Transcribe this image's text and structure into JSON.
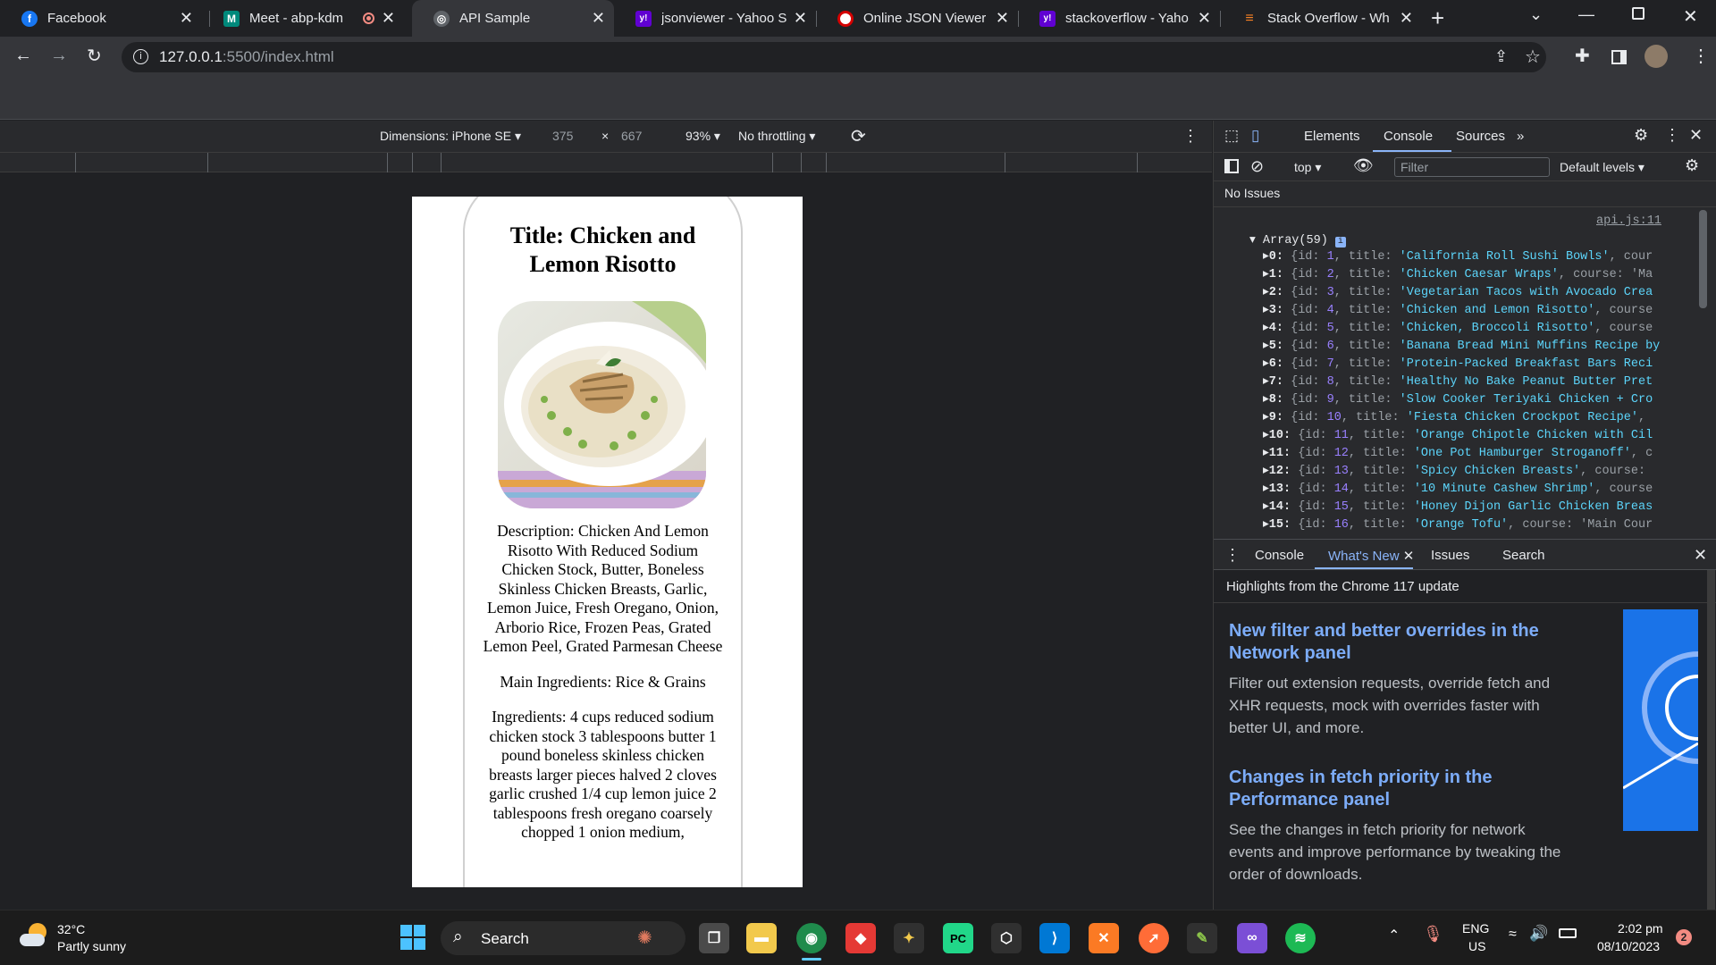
{
  "tabs": [
    {
      "label": "Facebook",
      "icon": "facebook-icon",
      "color": "#1877f2",
      "glyph": "f"
    },
    {
      "label": "Meet - abp-kdm",
      "icon": "meet-icon",
      "color": "#00897b",
      "glyph": "M"
    },
    {
      "label": "API Sample",
      "icon": "globe-icon",
      "color": "#5f6368",
      "glyph": "◎"
    },
    {
      "label": "jsonviewer - Yahoo S",
      "icon": "yahoo-icon",
      "color": "#6001d2",
      "glyph": "y!"
    },
    {
      "label": "Online JSON Viewer",
      "icon": "opera-icon",
      "color": "#d50000",
      "glyph": "O"
    },
    {
      "label": "stackoverflow - Yaho",
      "icon": "yahoo-icon",
      "color": "#6001d2",
      "glyph": "y!"
    },
    {
      "label": "Stack Overflow - Wh",
      "icon": "stackoverflow-icon",
      "color": "#f48024",
      "glyph": "≡"
    }
  ],
  "address": {
    "host": "127.0.0.1",
    "path": ":5500/index.html"
  },
  "device_toolbar": {
    "dimensions": "Dimensions: iPhone SE",
    "width": "375",
    "height": "667",
    "zoom": "93%",
    "throttling": "No throttling"
  },
  "page": {
    "title": "Title: Chicken and Lemon Risotto",
    "description": "Description: Chicken And Lemon Risotto With Reduced Sodium Chicken Stock, Butter, Boneless Skinless Chicken Breasts, Garlic, Lemon Juice, Fresh Oregano, Onion, Arborio Rice, Frozen Peas, Grated Lemon Peel, Grated Parmesan Cheese",
    "main_ingredients": "Main Ingredients: Rice & Grains",
    "ingredients": "Ingredients: 4 cups reduced sodium chicken stock 3 tablespoons butter 1 pound boneless skinless chicken breasts larger pieces halved 2 cloves garlic crushed 1/4 cup lemon juice 2 tablespoons fresh oregano coarsely chopped 1 onion medium,"
  },
  "devtools": {
    "tabs": [
      "Elements",
      "Console",
      "Sources"
    ],
    "active_tab": "Console",
    "context": "top",
    "filter_placeholder": "Filter",
    "levels": "Default levels",
    "issues": "No Issues",
    "source_link": "api.js:11",
    "array_label": "Array(59)",
    "rows": [
      {
        "i": "0",
        "id": "1",
        "title": "'California Roll Sushi Bowls'",
        "tail": ", cour"
      },
      {
        "i": "1",
        "id": "2",
        "title": "'Chicken Caesar Wraps'",
        "tail": ", course: 'Ma"
      },
      {
        "i": "2",
        "id": "3",
        "title": "'Vegetarian Tacos with Avocado Crea",
        "tail": ""
      },
      {
        "i": "3",
        "id": "4",
        "title": "'Chicken and Lemon Risotto'",
        "tail": ", course"
      },
      {
        "i": "4",
        "id": "5",
        "title": "'Chicken, Broccoli Risotto'",
        "tail": ", course"
      },
      {
        "i": "5",
        "id": "6",
        "title": "'Banana Bread Mini Muffins Recipe by",
        "tail": ""
      },
      {
        "i": "6",
        "id": "7",
        "title": "'Protein-Packed Breakfast Bars Reci",
        "tail": ""
      },
      {
        "i": "7",
        "id": "8",
        "title": "'Healthy No Bake Peanut Butter Pret",
        "tail": ""
      },
      {
        "i": "8",
        "id": "9",
        "title": "'Slow Cooker Teriyaki Chicken + Cro",
        "tail": ""
      },
      {
        "i": "9",
        "id": "10",
        "title": "'Fiesta Chicken Crockpot Recipe'",
        "tail": ","
      },
      {
        "i": "10",
        "id": "11",
        "title": "'Orange Chipotle Chicken with Cil",
        "tail": ""
      },
      {
        "i": "11",
        "id": "12",
        "title": "'One Pot Hamburger Stroganoff'",
        "tail": ", c"
      },
      {
        "i": "12",
        "id": "13",
        "title": "'Spicy Chicken Breasts'",
        "tail": ", course:"
      },
      {
        "i": "13",
        "id": "14",
        "title": "'10 Minute Cashew Shrimp'",
        "tail": ", course"
      },
      {
        "i": "14",
        "id": "15",
        "title": "'Honey Dijon Garlic Chicken Breas",
        "tail": ""
      },
      {
        "i": "15",
        "id": "16",
        "title": "'Orange Tofu'",
        "tail": ", course: 'Main Cour"
      }
    ],
    "drawer_tabs": [
      "Console",
      "What's New",
      "Issues",
      "Search"
    ],
    "drawer_active": "What's New",
    "highlights": "Highlights from the Chrome 117 update",
    "news": [
      {
        "heading": "New filter and better overrides in the Network panel",
        "body": "Filter out extension requests, override fetch and XHR requests, mock with overrides faster with better UI, and more."
      },
      {
        "heading": "Changes in fetch priority in the Performance panel",
        "body": "See the changes in fetch priority for network events and improve performance by tweaking the order of downloads."
      }
    ]
  },
  "taskbar": {
    "weather_temp": "32°C",
    "weather_desc": "Partly sunny",
    "search": "Search",
    "lang": "ENG",
    "region": "US",
    "time": "2:02 pm",
    "date": "08/10/2023",
    "notifications": "2"
  },
  "colors": {
    "accent": "#8ab4f8",
    "link": "#7cacf8",
    "string": "#5cd5fb",
    "number": "#9980ff"
  }
}
